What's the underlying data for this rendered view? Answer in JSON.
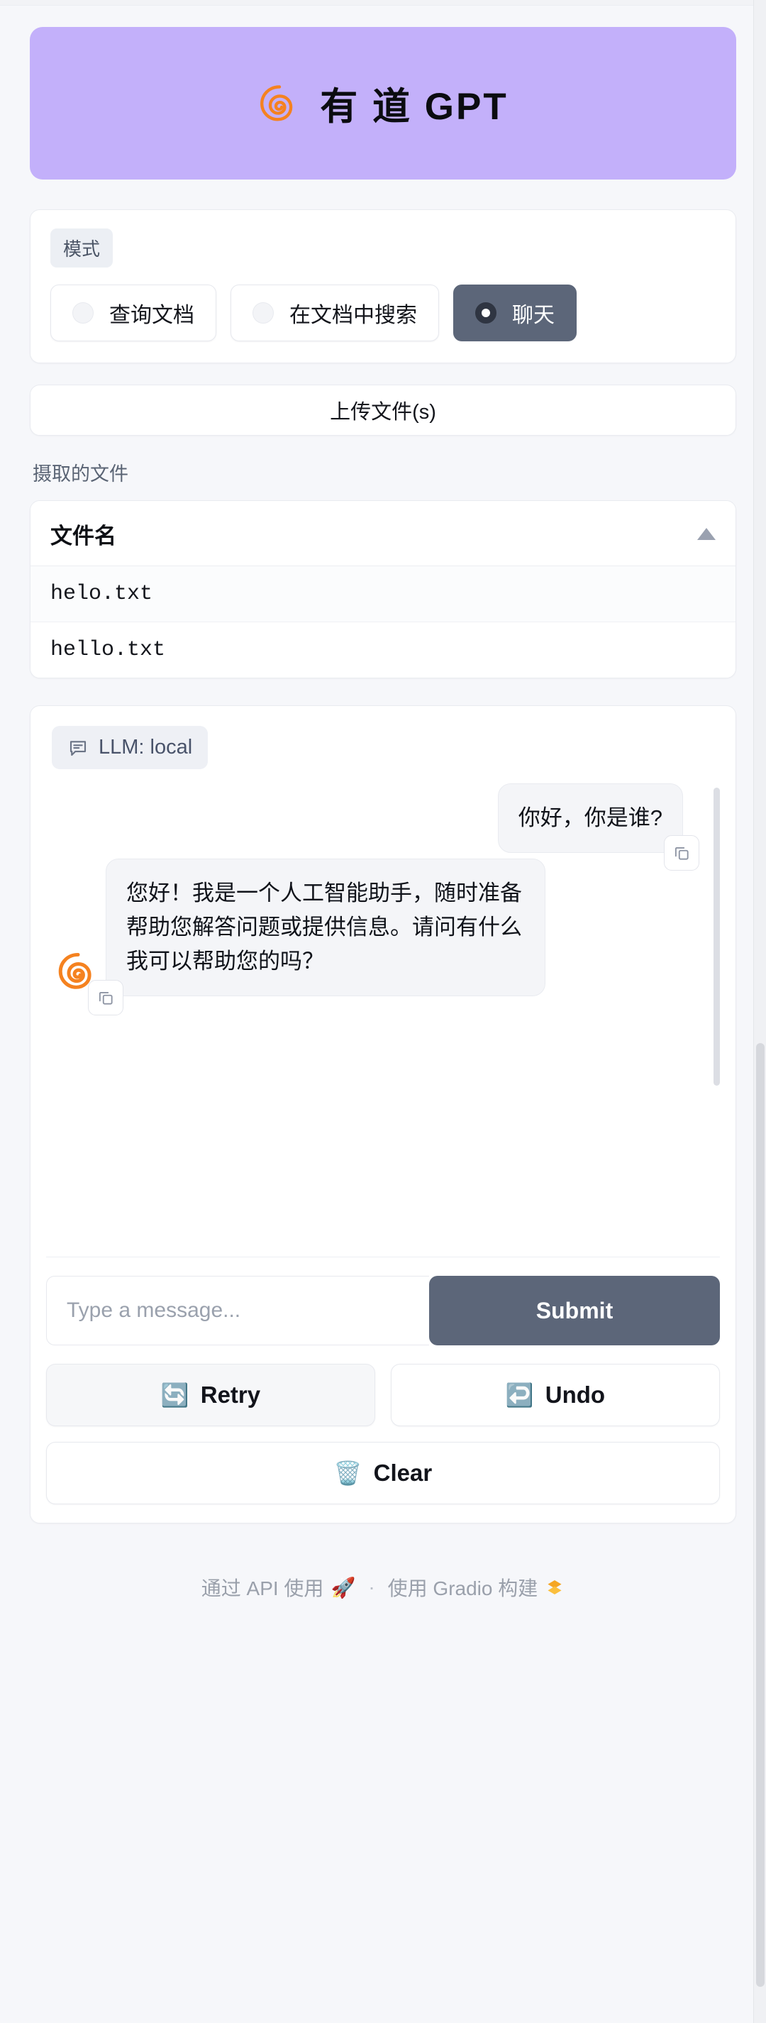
{
  "header": {
    "title": "有 道 GPT",
    "logo_icon": "spiral-logo",
    "background_color": "#c3b0fa"
  },
  "mode": {
    "label": "模式",
    "options": [
      {
        "label": "查询文档",
        "selected": false
      },
      {
        "label": "在文档中搜索",
        "selected": false
      },
      {
        "label": "聊天",
        "selected": true
      }
    ]
  },
  "upload": {
    "button_label": "上传文件(s)"
  },
  "files": {
    "caption": "摄取的文件",
    "column_header": "文件名",
    "sort_icon": "sort-ascending-triangle-icon",
    "rows": [
      {
        "name": "helo.txt"
      },
      {
        "name": "hello.txt"
      }
    ]
  },
  "chat": {
    "llm_badge": {
      "icon": "chat-bubble-icon",
      "text": "LLM: local"
    },
    "messages": [
      {
        "role": "user",
        "text": "你好，你是谁?",
        "copy_icon": "copy-icon"
      },
      {
        "role": "assistant",
        "text": "您好！我是一个人工智能助手，随时准备帮助您解答问题或提供信息。请问有什么我可以帮助您的吗？",
        "avatar_icon": "spiral-avatar-icon",
        "copy_icon": "copy-icon"
      }
    ],
    "input": {
      "value": "",
      "placeholder": "Type a message..."
    },
    "submit_label": "Submit"
  },
  "actions": {
    "retry": {
      "emoji": "🔄",
      "label": "Retry",
      "icon_name": "retry-icon"
    },
    "undo": {
      "emoji": "↩️",
      "label": "Undo",
      "icon_name": "undo-icon"
    },
    "clear": {
      "emoji": "🗑️",
      "label": "Clear",
      "icon_name": "trash-icon"
    }
  },
  "footer": {
    "api_text": "通过 API 使用",
    "api_emoji": "🚀",
    "separator": "·",
    "gradio_text": "使用 Gradio 构建",
    "gradio_icon": "gradio-logo-icon"
  },
  "colors": {
    "accent_purple": "#c3b0fa",
    "accent_orange": "#f58220",
    "selected_slate": "#5c6679",
    "page_bg": "#f6f7fa"
  }
}
